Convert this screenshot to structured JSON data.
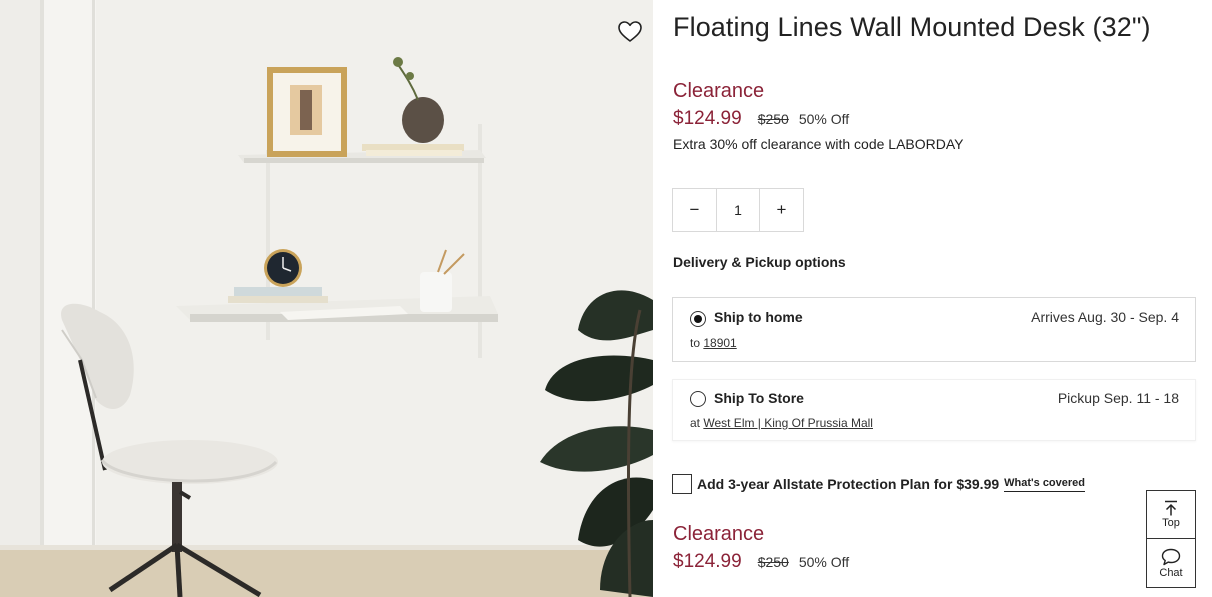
{
  "product": {
    "title": "Floating Lines Wall Mounted Desk (32\")",
    "favorite_icon": "heart-outline-icon"
  },
  "pricing": {
    "label": "Clearance",
    "sale_price": "$124.99",
    "original_price": "$250",
    "discount": "50% Off",
    "promo_text": "Extra 30% off clearance with code LABORDAY"
  },
  "quantity": {
    "minus_label": "−",
    "value": "1",
    "plus_label": "+"
  },
  "delivery": {
    "heading": "Delivery & Pickup options",
    "options": [
      {
        "label": "Ship to home",
        "date": "Arrives Aug. 30 - Sep. 4",
        "sub_prefix": "to",
        "sub_link": "18901",
        "selected": true
      },
      {
        "label": "Ship To Store",
        "date": "Pickup Sep. 11 - 18",
        "sub_prefix": "at",
        "sub_link": "West Elm | King Of Prussia Mall",
        "selected": false
      }
    ]
  },
  "protection": {
    "label": "Add 3-year Allstate Protection Plan for $39.99",
    "link": "What's covered",
    "checked": false
  },
  "floating": {
    "top_label": "Top",
    "top_icon": "arrow-up-to-line-icon",
    "chat_label": "Chat",
    "chat_icon": "chat-bubble-icon"
  },
  "colors": {
    "accent_red": "#8b2338",
    "text": "#222222",
    "border": "#d9d9d9"
  }
}
